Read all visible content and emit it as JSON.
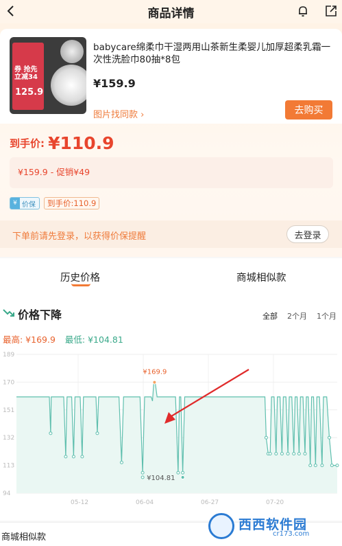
{
  "header": {
    "title": "商品详情"
  },
  "product": {
    "title": "babycare绵柔巾干湿两用山茶新生柔婴儿加厚超柔乳霜一次性洗脸巾80抽*8包",
    "price": "¥159.9",
    "find_similar": "图片找同款 ›",
    "buy_label": "去购买",
    "thumb_text": "券 抢先立减34",
    "thumb_price": "125.9"
  },
  "final_price": {
    "label": "到手价:",
    "value": "¥110.9"
  },
  "promo": {
    "text": "¥159.9  -  促销¥49"
  },
  "tags": {
    "protect": "价保",
    "protect_icon": "¥",
    "final": "到手价:110.9"
  },
  "login": {
    "tip": "下单前请先登录，以获得价保提醒",
    "button": "去登录"
  },
  "tabs": [
    {
      "label": "历史价格",
      "active": true
    },
    {
      "label": "商城相似款",
      "active": false
    }
  ],
  "chart_section": {
    "title": "价格下降",
    "ranges": [
      "全部",
      "2个月",
      "1个月"
    ],
    "highest": "最高: ¥169.9",
    "lowest": "最低: ¥104.81"
  },
  "colors": {
    "accent": "#f27a35",
    "price_red": "#e8452d",
    "line": "#5fbfae",
    "high": "#e8622d"
  },
  "chart_data": {
    "type": "line",
    "title": "",
    "xlabel": "",
    "ylabel": "",
    "x_ticks": [
      "05-12",
      "06-04",
      "06-27",
      "07-20"
    ],
    "y_ticks": [
      94,
      113,
      132,
      151,
      170,
      189
    ],
    "ylim": [
      94,
      189
    ],
    "grid": true,
    "annotations": [
      {
        "text": "¥169.9",
        "value": 169.9,
        "kind": "max"
      },
      {
        "text": "¥104.81",
        "value": 104.81,
        "kind": "min"
      }
    ],
    "series": [
      {
        "values": [
          159.9,
          159.9,
          159.9,
          159.9,
          159.9,
          159.9,
          159.9,
          159.9,
          159.9,
          159.9,
          159.9,
          159.9,
          159.9,
          159.9,
          159.9,
          159.9,
          159.9,
          159.9,
          159.9,
          159.9,
          159.9,
          159.9,
          159.9,
          159.9,
          159.9,
          159.9,
          159.9,
          159.9,
          159.9,
          159.9,
          159.9,
          159.9,
          159.9,
          159.9,
          159.9,
          159.9,
          159.9,
          159.9,
          159.9,
          159.9,
          159.9,
          159.9,
          159.9,
          159.9,
          159.9,
          159.9,
          159.9,
          159.9,
          159.9,
          159.9,
          159.9,
          159.9,
          159.9,
          159.9,
          159.9,
          159.9,
          159.9,
          159.9,
          159.9,
          159.9,
          159.9,
          159.9,
          159.9,
          159.9,
          159.9,
          159.9,
          159.9,
          159.9,
          159.9,
          159.9,
          159.9,
          159.9,
          159.9,
          159.9,
          159.9,
          159.9,
          159.9,
          159.9,
          159.9,
          159.9,
          159.9,
          159.9,
          159.9,
          159.9,
          159.9,
          159.9,
          159.9,
          159.9,
          159.9,
          159.9,
          159.9,
          159.9,
          159.9,
          159.9,
          159.9,
          159.9,
          159.9,
          159.9,
          159.9,
          159.9,
          159.9,
          159.9,
          159.9,
          159.9,
          159.9,
          159.9,
          159.9,
          159.9,
          159.9,
          159.9,
          159.9,
          159.9,
          159.9,
          159.9,
          159.9,
          159.9,
          159.9,
          159.9,
          159.9,
          159.9,
          159.9,
          159.9,
          159.9,
          159.9,
          159.9
        ],
        "shape": [
          [
            0,
            159.9
          ],
          [
            50,
            159.9
          ],
          [
            52,
            135
          ],
          [
            53,
            159.9
          ],
          [
            72,
            159.9
          ],
          [
            75,
            119
          ],
          [
            77,
            159.9
          ],
          [
            84,
            159.9
          ],
          [
            87,
            119
          ],
          [
            89,
            159.9
          ],
          [
            97,
            159.9
          ],
          [
            100,
            119
          ],
          [
            102,
            159.9
          ],
          [
            121,
            159.9
          ],
          [
            123,
            135
          ],
          [
            125,
            159.9
          ],
          [
            156,
            159.9
          ],
          [
            160,
            115
          ],
          [
            163,
            159.9
          ],
          [
            188,
            159.9
          ],
          [
            192,
            108
          ],
          [
            195,
            159.9
          ],
          [
            205,
            159.9
          ],
          [
            207,
            157
          ],
          [
            209,
            169.9
          ],
          [
            211,
            169.9
          ],
          [
            214,
            159.9
          ],
          [
            242,
            159.9
          ],
          [
            246,
            108
          ],
          [
            248,
            159.9
          ],
          [
            250,
            159.9
          ],
          [
            253,
            108
          ],
          [
            256,
            159.9
          ],
          [
            378,
            159.9
          ],
          [
            380,
            132
          ],
          [
            383,
            121
          ],
          [
            386,
            121
          ],
          [
            388,
            159.9
          ],
          [
            392,
            159.9
          ],
          [
            395,
            121
          ],
          [
            397,
            159.9
          ],
          [
            401,
            159.9
          ],
          [
            404,
            121
          ],
          [
            406,
            159.9
          ],
          [
            410,
            159.9
          ],
          [
            413,
            121
          ],
          [
            415,
            159.9
          ],
          [
            419,
            159.9
          ],
          [
            422,
            121
          ],
          [
            424,
            159.9
          ],
          [
            427,
            159.9
          ],
          [
            430,
            121
          ],
          [
            432,
            159.9
          ],
          [
            436,
            159.9
          ],
          [
            439,
            121
          ],
          [
            441,
            159.9
          ],
          [
            444,
            159.9
          ],
          [
            447,
            113
          ],
          [
            449,
            159.9
          ],
          [
            452,
            159.9
          ],
          [
            455,
            113
          ],
          [
            457,
            159.9
          ],
          [
            461,
            159.9
          ],
          [
            465,
            113
          ],
          [
            467,
            159.9
          ],
          [
            472,
            159.9
          ],
          [
            476,
            132
          ],
          [
            480,
            113
          ],
          [
            488,
            113
          ]
        ]
      }
    ]
  }
}
